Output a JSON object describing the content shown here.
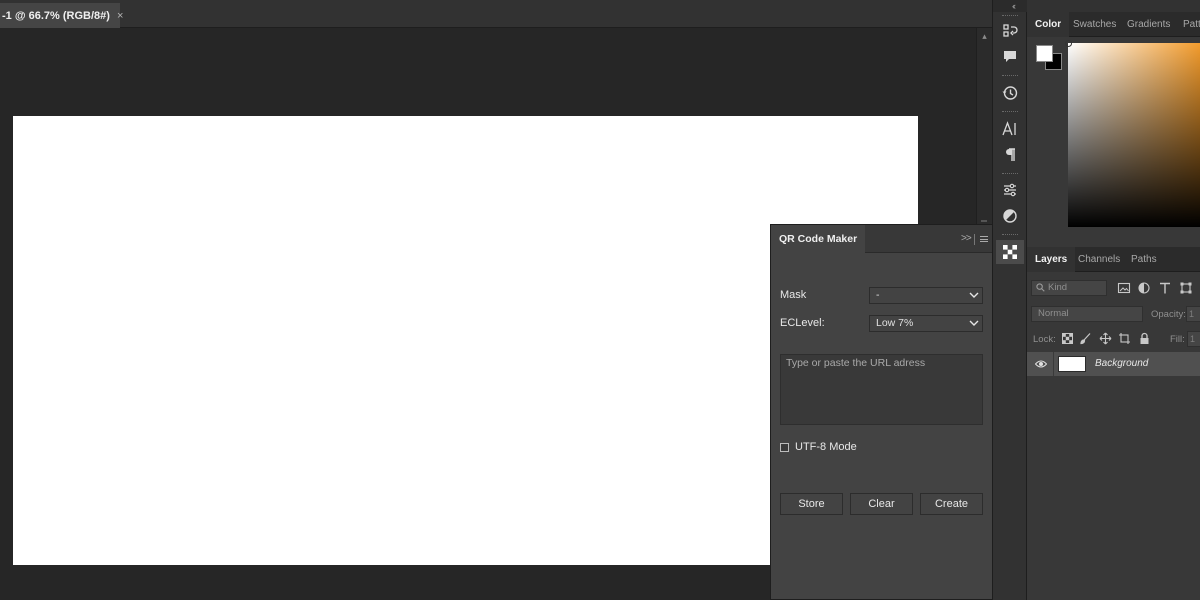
{
  "document": {
    "tab_title": "-1 @ 66.7% (RGB/8#)",
    "close_glyph": "×"
  },
  "dock": {
    "icons": [
      "learn-icon",
      "comments-icon",
      "history-icon",
      "character-icon",
      "paragraph-icon",
      "properties-icon",
      "adjustments-icon",
      "qr-plugin-icon"
    ]
  },
  "qr_panel": {
    "title": "QR Code Maker",
    "expand_glyph": ">>",
    "mask_label": "Mask",
    "mask_value": "-",
    "eclevel_label": "ECLevel:",
    "eclevel_value": "Low 7%",
    "url_placeholder": "Type or paste the URL adress",
    "utf8_label": "UTF-8 Mode",
    "store_label": "Store",
    "clear_label": "Clear",
    "create_label": "Create"
  },
  "color_panel": {
    "tabs": [
      "Color",
      "Swatches",
      "Gradients",
      "Patt"
    ],
    "foreground": "#ffffff",
    "background": "#000000",
    "hue": "#f39c2d"
  },
  "layers_panel": {
    "tabs": [
      "Layers",
      "Channels",
      "Paths"
    ],
    "kind_placeholder": "Kind",
    "blend_mode": "Normal",
    "opacity_label": "Opacity:",
    "opacity_value": "1",
    "lock_label": "Lock:",
    "fill_label": "Fill:",
    "fill_value": "1",
    "layers": [
      {
        "name": "Background",
        "visible": true
      }
    ]
  }
}
